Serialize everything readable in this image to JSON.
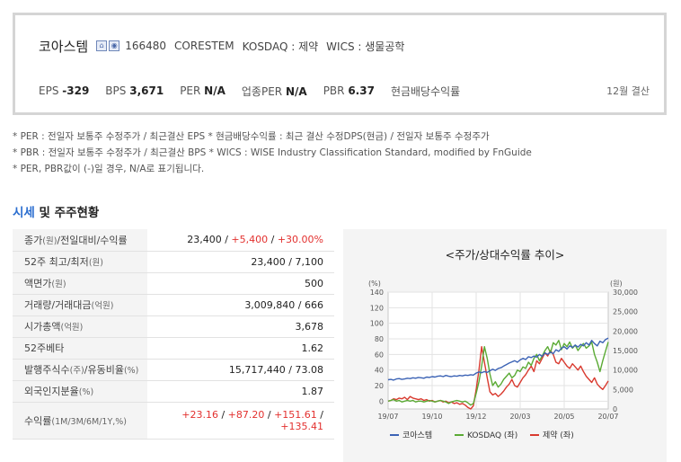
{
  "company": {
    "name": "코아스템",
    "icon_a": "building-icon",
    "icon_b": "camera-icon",
    "code": "166480",
    "english_name": "CORESTEM",
    "market": "KOSDAQ : 제약",
    "wics": "WICS : 생물공학"
  },
  "metrics": {
    "eps_label": "EPS",
    "eps": "-329",
    "bps_label": "BPS",
    "bps": "3,671",
    "per_label": "PER",
    "per": "N/A",
    "industry_per_label": "업종PER",
    "industry_per": "N/A",
    "pbr_label": "PBR",
    "pbr": "6.37",
    "dividend_label": "현금배당수익률",
    "settlement": "12월 결산"
  },
  "notes": [
    "* PER : 전일자 보통주 수정주가 / 최근결산 EPS * 현금배당수익률 : 최근 결산 수정DPS(현금) / 전일자 보통주 수정주가",
    "* PBR : 전일자 보통주 수정주가 / 최근결산 BPS * WICS : WISE Industry Classification Standard, modified by FnGuide",
    "* PER, PBR값이 (-)일 경우, N/A로 표기됩니다."
  ],
  "section": {
    "title_accent": "시세",
    "title_rest": " 및 주주현황"
  },
  "stats": {
    "close": {
      "label": "종가",
      "unit": "(원)",
      "label2": "/전일대비/수익률",
      "price": "23,400",
      "sep1": " / ",
      "change": "+5,400",
      "sep2": " / ",
      "rate": "+30.00%"
    },
    "high_low": {
      "label": "52주 최고/최저",
      "unit": "(원)",
      "value": "23,400 / 7,100"
    },
    "par": {
      "label": "액면가",
      "unit": "(원)",
      "value": "500"
    },
    "volume": {
      "label": "거래량/거래대금",
      "unit": "(억원)",
      "value": "3,009,840 / 666"
    },
    "market_cap": {
      "label": "시가총액",
      "unit": "(억원)",
      "value": "3,678"
    },
    "beta": {
      "label": "52주베타",
      "value": "1.62"
    },
    "shares": {
      "label": "발행주식수",
      "unit": "(주)",
      "label2": "/유동비율",
      "unit2": "(%)",
      "value": "15,717,440 / 73.08"
    },
    "foreign": {
      "label": "외국인지분율",
      "unit": "(%)",
      "value": "1.87"
    },
    "returns": {
      "label": "수익률",
      "unit": "(1M/3M/6M/1Y,%)",
      "r1": "+23.16",
      "r2": "+87.20",
      "r3": "+151.61",
      "r4": "+135.41",
      "sep": " / "
    }
  },
  "chart_data": {
    "type": "line",
    "title": "<주가/상대수익률 추이>",
    "left_axis_unit": "(%)",
    "right_axis_unit": "(원)",
    "left_ticks": [
      "0",
      "20",
      "40",
      "60",
      "80",
      "100",
      "120",
      "140"
    ],
    "right_ticks": [
      "0",
      "5,000",
      "10,000",
      "15,000",
      "20,000",
      "25,000",
      "30,000"
    ],
    "x_ticks": [
      "19/07",
      "19/10",
      "19/12",
      "20/03",
      "20/05",
      "20/07"
    ],
    "ylim_left": [
      -10,
      140
    ],
    "ylim_right": [
      0,
      30000
    ],
    "grid": true,
    "legend_position": "bottom",
    "series": [
      {
        "name": "코아스템",
        "axis": "right",
        "color": "#3c63b5",
        "values": [
          7500,
          7600,
          7400,
          7700,
          7800,
          7600,
          7700,
          7900,
          7800,
          8000,
          7900,
          8100,
          8000,
          7900,
          8200,
          8100,
          8300,
          8200,
          8400,
          8500,
          8300,
          8600,
          8400,
          8300,
          8500,
          8400,
          8600,
          8500,
          8700,
          8600,
          8800,
          8700,
          9200,
          9500,
          9300,
          9600,
          9400,
          9800,
          10200,
          9900,
          10400,
          10600,
          11000,
          11400,
          11800,
          12100,
          12400,
          12000,
          12600,
          13000,
          12700,
          13400,
          13200,
          13600,
          13300,
          14000,
          13500,
          14400,
          14000,
          14600,
          14200,
          15200,
          14800,
          15600,
          16000,
          15400,
          16200,
          15800,
          16400,
          15900,
          16600,
          16200,
          17000,
          16400,
          17600,
          16800,
          16200,
          17400,
          17000,
          17800,
          18200
        ]
      },
      {
        "name": "KOSDAQ (좌)",
        "axis": "left",
        "color": "#5aaa34",
        "values": [
          0,
          1,
          2,
          0,
          1,
          -1,
          0,
          1,
          0,
          1,
          -1,
          0,
          0,
          -1,
          0,
          1,
          0,
          -1,
          0,
          1,
          0,
          -1,
          -3,
          -1,
          0,
          1,
          0,
          -1,
          0,
          -2,
          -5,
          -3,
          10,
          25,
          45,
          70,
          55,
          35,
          20,
          25,
          18,
          22,
          28,
          32,
          36,
          30,
          33,
          40,
          38,
          44,
          42,
          50,
          46,
          55,
          60,
          52,
          58,
          65,
          70,
          62,
          75,
          72,
          78,
          66,
          74,
          70,
          76,
          68,
          72,
          65,
          70,
          74,
          68,
          71,
          76,
          60,
          50,
          38,
          52,
          64,
          76
        ]
      },
      {
        "name": "제약 (좌)",
        "axis": "left",
        "color": "#d93a2f",
        "values": [
          0,
          1,
          3,
          2,
          4,
          3,
          5,
          2,
          6,
          4,
          3,
          2,
          3,
          1,
          2,
          0,
          1,
          -1,
          0,
          1,
          -1,
          0,
          -2,
          -1,
          -3,
          -2,
          -4,
          -3,
          -5,
          -8,
          -10,
          -6,
          15,
          40,
          70,
          50,
          30,
          12,
          8,
          10,
          6,
          9,
          13,
          18,
          22,
          28,
          20,
          18,
          24,
          30,
          34,
          40,
          45,
          38,
          52,
          48,
          55,
          62,
          58,
          65,
          60,
          50,
          48,
          55,
          50,
          45,
          42,
          48,
          44,
          40,
          45,
          38,
          32,
          28,
          24,
          30,
          22,
          18,
          15,
          20,
          26
        ]
      }
    ]
  }
}
